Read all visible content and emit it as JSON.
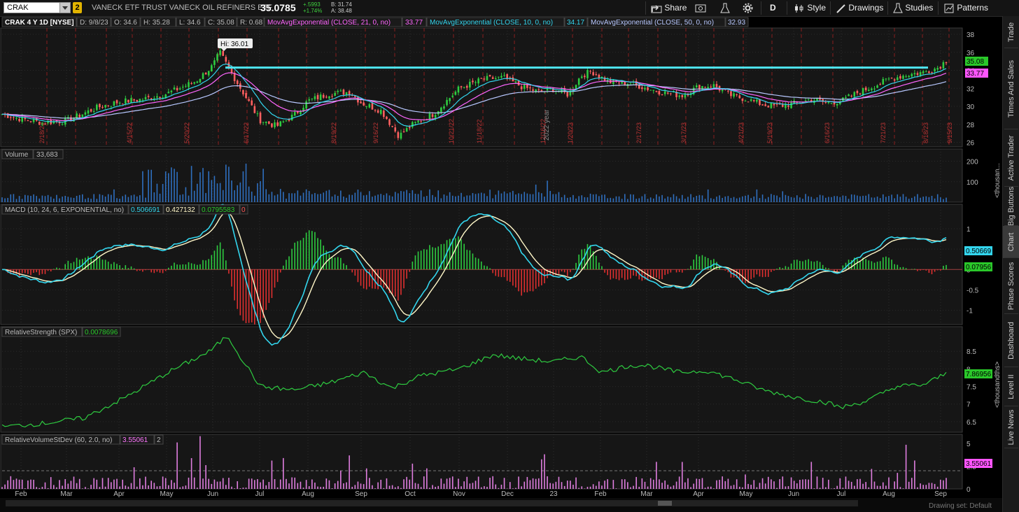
{
  "header": {
    "symbol": "CRAK",
    "link_badge": "2",
    "description": "VANECK ETF TRUST VANECK OIL REFINERS ETF",
    "last": "35.0785",
    "change": "+.5993",
    "change_pct": "+1.74%",
    "bid": "B: 31.74",
    "ask": "A: 38.48"
  },
  "toolbar": {
    "share": "Share",
    "period": "D",
    "style": "Style",
    "drawings": "Drawings",
    "studies": "Studies",
    "patterns": "Patterns"
  },
  "sidebar": {
    "tabs": [
      "Trade",
      "Times And Sales",
      "Active Trader",
      "Big Buttons",
      "Chart",
      "Phase Scores",
      "Dashboard",
      "Level II",
      "Live News"
    ],
    "active": "Chart"
  },
  "price_panel": {
    "title": "CRAK 4 Y 1D [NYSE]",
    "ohlc": [
      "D: 9/8/23",
      "O: 34.6",
      "H: 35.28",
      "L: 34.6",
      "C: 35.08",
      "R: 0.68"
    ],
    "studies": [
      {
        "label": "MovAvgExponential (CLOSE, 21, 0, no)",
        "value": "33.77",
        "color": "#ff66ff"
      },
      {
        "label": "MovAvgExponential (CLOSE, 10, 0, no)",
        "value": "34.17",
        "color": "#33d6ee"
      },
      {
        "label": "MovAvgExponential (CLOSE, 50, 0, no)",
        "value": "32.93",
        "color": "#b8c8ff"
      }
    ],
    "hi_label": "Hi: 36.01",
    "year_marker": "2022 year",
    "last_tag": "35.08",
    "ema_tag": "33.77",
    "y_ticks": [
      26,
      28,
      30,
      32,
      34,
      36,
      38
    ],
    "vertical_dates": [
      "2/18/22",
      "4/15/22",
      "5/20/22",
      "6/17/22",
      "8/19/22",
      "9/16/22",
      "10/21/22",
      "11/18/22",
      "12/16/22",
      "1/20/23",
      "2/17/23",
      "3/17/23",
      "4/21/23",
      "5/19/23",
      "6/16/23",
      "7/21/23",
      "8/18/23",
      "9/15/23"
    ]
  },
  "volume_panel": {
    "title": "Volume",
    "value": "33,683",
    "y_ticks": [
      "200",
      "100"
    ],
    "unit_label": "<thousan..."
  },
  "macd_panel": {
    "title": "MACD (10, 24, 6, EXPONENTIAL, no)",
    "values": [
      "0.506691",
      "0.427132",
      "0.0795583",
      "0"
    ],
    "tag_value": "0.50669",
    "tag_diff": "0.07956",
    "y_ticks": [
      "1",
      "0.5",
      "0",
      "-0.5",
      "-1"
    ]
  },
  "rs_panel": {
    "title": "RelativeStrength (SPX)",
    "value": "0.0078696",
    "tag": "7.86956",
    "y_ticks": [
      "8.5",
      "8",
      "7.5",
      "7",
      "6.5"
    ],
    "unit_label": "<thousandths>"
  },
  "rvol_panel": {
    "title": "RelativeVolumeStDev (60, 2.0, no)",
    "values": [
      "3.55061",
      "2"
    ],
    "tag": "3.55061",
    "y_ticks": [
      "5",
      "2.5",
      "0"
    ]
  },
  "x_axis": {
    "months": [
      "Feb",
      "Mar",
      "Apr",
      "May",
      "Jun",
      "Jul",
      "Aug",
      "Sep",
      "Oct",
      "Nov",
      "Dec",
      "23",
      "Feb",
      "Mar",
      "Apr",
      "May",
      "Jun",
      "Jul",
      "Aug",
      "Sep"
    ]
  },
  "footer": {
    "drawing_set": "Drawing set: Default"
  },
  "chart_data": {
    "type": "candlestick",
    "title": "CRAK 4 Y 1D [NYSE]",
    "period": "Feb 2022 - Sep 2023",
    "resistance_level": 34.3,
    "price_close_approx": {
      "x": [
        "2022-02",
        "2022-03",
        "2022-04",
        "2022-05",
        "2022-06-08",
        "2022-07",
        "2022-08",
        "2022-09",
        "2022-10",
        "2022-11",
        "2022-12",
        "2023-01",
        "2023-02",
        "2023-03",
        "2023-04",
        "2023-05",
        "2023-06",
        "2023-07",
        "2023-08",
        "2023-09-08"
      ],
      "y": [
        28.6,
        28.4,
        30.5,
        31.4,
        36.0,
        28.2,
        30.8,
        30.2,
        27.2,
        32.8,
        32.0,
        31.7,
        33.4,
        31.8,
        32.2,
        30.0,
        30.4,
        30.9,
        33.3,
        35.08
      ]
    },
    "rs_approx": {
      "x": [
        "2022-02",
        "2022-03",
        "2022-04",
        "2022-05",
        "2022-06",
        "2022-07",
        "2022-08",
        "2022-09",
        "2022-10",
        "2022-11",
        "2022-12",
        "2023-01",
        "2023-02",
        "2023-03",
        "2023-04",
        "2023-05",
        "2023-06",
        "2023-07",
        "2023-08",
        "2023-09"
      ],
      "y": [
        6.4,
        6.45,
        6.9,
        7.9,
        8.9,
        7.5,
        7.6,
        7.9,
        7.7,
        8.3,
        8.2,
        8.2,
        8.1,
        8.0,
        7.9,
        7.5,
        7.1,
        6.9,
        7.5,
        7.87
      ]
    },
    "macd_approx": {
      "x": [
        "2022-02",
        "2022-03",
        "2022-04",
        "2022-05",
        "2022-06",
        "2022-07",
        "2022-08",
        "2022-09",
        "2022-10",
        "2022-11",
        "2022-12",
        "2023-01",
        "2023-02",
        "2023-03",
        "2023-04",
        "2023-05",
        "2023-06",
        "2023-07",
        "2023-08",
        "2023-09"
      ],
      "y": [
        0.1,
        -0.3,
        0.6,
        0.3,
        1.3,
        -1.3,
        0.6,
        -0.2,
        -0.9,
        1.0,
        0.2,
        -0.2,
        0.7,
        -0.3,
        0.3,
        -0.5,
        0.2,
        0.2,
        0.7,
        0.51
      ]
    }
  }
}
